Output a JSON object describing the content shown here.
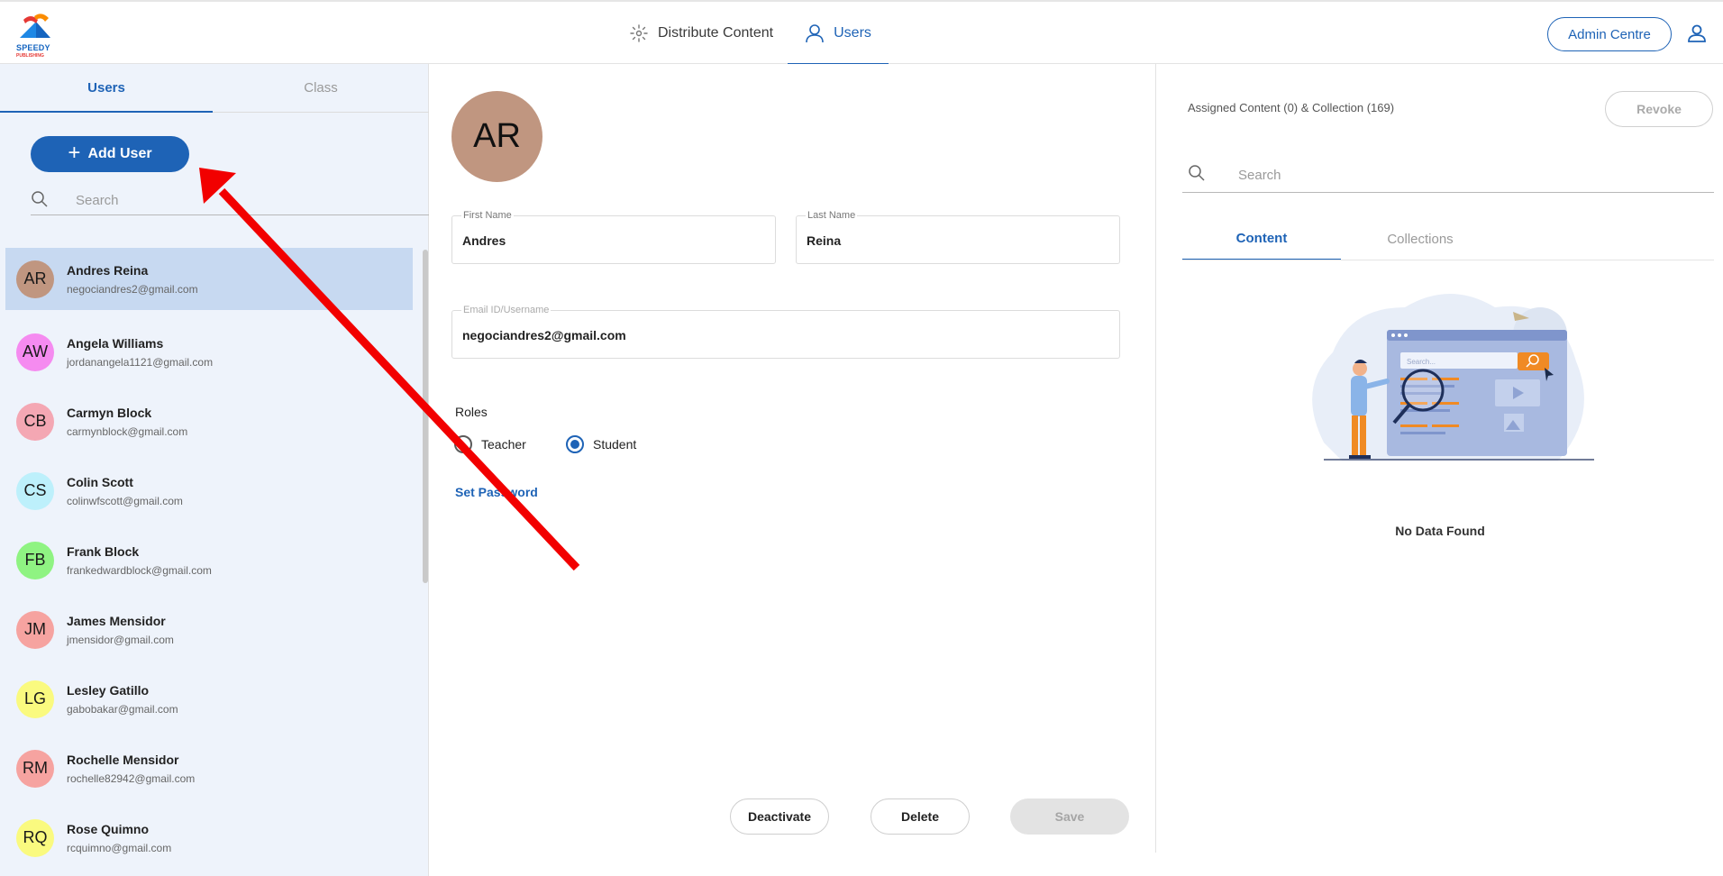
{
  "header": {
    "logo_text": "SPEEDY",
    "logo_subtext": "PUBLISHING",
    "nav": {
      "distribute_label": "Distribute Content",
      "users_label": "Users"
    },
    "admin_label": "Admin Centre",
    "colors": {
      "accent": "#1e63b6"
    }
  },
  "left_panel": {
    "tabs": [
      {
        "label": "Users",
        "active": true
      },
      {
        "label": "Class",
        "active": false
      }
    ],
    "add_user_label": "Add User",
    "search_placeholder": "Search",
    "users": [
      {
        "initials": "AR",
        "name": "Andres Reina",
        "email": "negociandres2@gmail.com",
        "color": "#c09680",
        "selected": true
      },
      {
        "initials": "AW",
        "name": "Angela Williams",
        "email": "jordanangela1121@gmail.com",
        "color": "#f58bf0",
        "selected": false
      },
      {
        "initials": "CB",
        "name": "Carmyn Block",
        "email": "carmynblock@gmail.com",
        "color": "#f4a7b3",
        "selected": false
      },
      {
        "initials": "CS",
        "name": "Colin Scott",
        "email": "colinwfscott@gmail.com",
        "color": "#bdf0fb",
        "selected": false
      },
      {
        "initials": "FB",
        "name": "Frank Block",
        "email": "frankedwardblock@gmail.com",
        "color": "#8ff382",
        "selected": false
      },
      {
        "initials": "JM",
        "name": "James Mensidor",
        "email": "jmensidor@gmail.com",
        "color": "#f6a3a0",
        "selected": false
      },
      {
        "initials": "LG",
        "name": "Lesley Gatillo",
        "email": "gabobakar@gmail.com",
        "color": "#fafa7f",
        "selected": false
      },
      {
        "initials": "RM",
        "name": "Rochelle Mensidor",
        "email": "rochelle82942@gmail.com",
        "color": "#f6a3a0",
        "selected": false
      },
      {
        "initials": "RQ",
        "name": "Rose Quimno",
        "email": "rcquimno@gmail.com",
        "color": "#fafa7f",
        "selected": false
      }
    ]
  },
  "detail": {
    "avatar_initials": "AR",
    "first_name_label": "First Name",
    "first_name": "Andres",
    "last_name_label": "Last Name",
    "last_name": "Reina",
    "email_label": "Email ID/Username",
    "email": "negociandres2@gmail.com",
    "roles_title": "Roles",
    "role_teacher": "Teacher",
    "role_student": "Student",
    "selected_role": "Student",
    "set_password_label": "Set Password",
    "deactivate_label": "Deactivate",
    "delete_label": "Delete",
    "save_label": "Save"
  },
  "right_panel": {
    "assigned_label": "Assigned Content (0) & Collection (169)",
    "revoke_label": "Revoke",
    "search_placeholder": "Search",
    "tabs": [
      {
        "label": "Content",
        "active": true
      },
      {
        "label": "Collections",
        "active": false
      }
    ],
    "illustration_search_text": "Search...",
    "empty_text": "No Data Found"
  }
}
